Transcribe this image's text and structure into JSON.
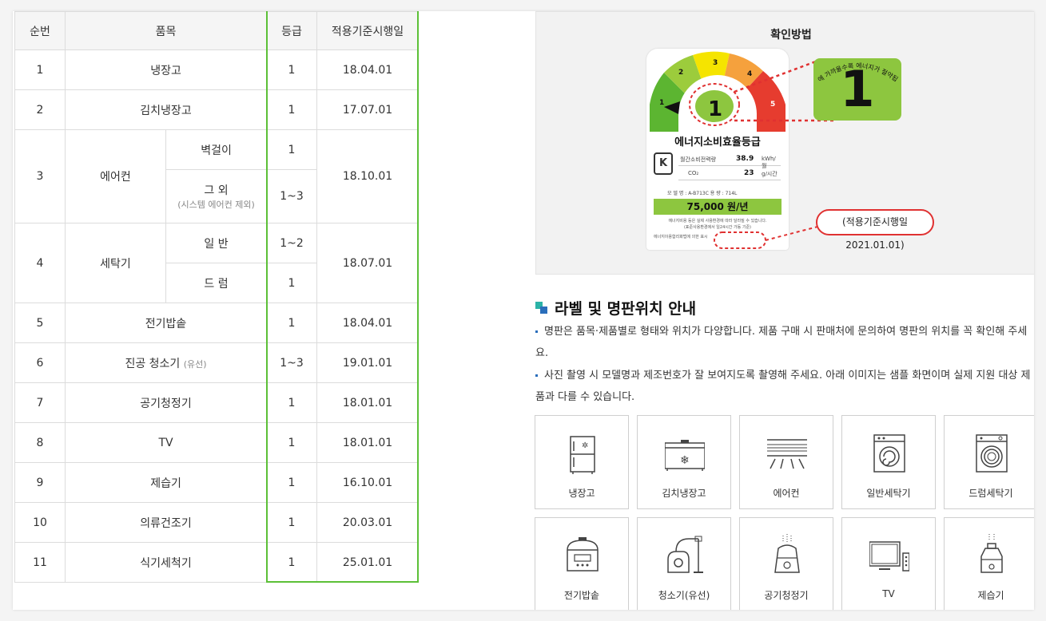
{
  "table": {
    "headers": {
      "no": "순번",
      "item": "품목",
      "grade": "등급",
      "date": "적용기준시행일"
    },
    "rows": [
      {
        "no": "1",
        "item": "냉장고",
        "grade": "1",
        "date": "18.04.01"
      },
      {
        "no": "2",
        "item": "김치냉장고",
        "grade": "1",
        "date": "17.07.01"
      },
      {
        "no": "3",
        "item": "에어컨",
        "date": "18.10.01",
        "sub": [
          {
            "name": "벽걸이",
            "grade": "1"
          },
          {
            "name": "그 외",
            "note": "(시스템 에어컨 제외)",
            "grade": "1~3"
          }
        ]
      },
      {
        "no": "4",
        "item": "세탁기",
        "date": "18.07.01",
        "sub": [
          {
            "name": "일 반",
            "grade": "1~2"
          },
          {
            "name": "드 럼",
            "grade": "1"
          }
        ]
      },
      {
        "no": "5",
        "item": "전기밥솥",
        "grade": "1",
        "date": "18.04.01"
      },
      {
        "no": "6",
        "item": "진공 청소기",
        "item_note": "(유선)",
        "grade": "1~3",
        "date": "19.01.01"
      },
      {
        "no": "7",
        "item": "공기청정기",
        "grade": "1",
        "date": "18.01.01"
      },
      {
        "no": "8",
        "item": "TV",
        "grade": "1",
        "date": "18.01.01"
      },
      {
        "no": "9",
        "item": "제습기",
        "grade": "1",
        "date": "16.10.01"
      },
      {
        "no": "10",
        "item": "의류건조기",
        "grade": "1",
        "date": "20.03.01"
      },
      {
        "no": "11",
        "item": "식기세척기",
        "grade": "1",
        "date": "25.01.01"
      }
    ]
  },
  "check": {
    "title": "확인방법",
    "label": {
      "gauge_numbers": [
        "1",
        "2",
        "3",
        "4",
        "5"
      ],
      "gauge_colors": [
        "#5cb531",
        "#9ccc3c",
        "#f5e400",
        "#f5a13d",
        "#e63c2f"
      ],
      "grade": "1",
      "title": "에너지소비효율등급",
      "kc": "K",
      "spec1_label": "월간소비전력량",
      "spec1_value": "38.9",
      "spec1_unit": "kWh/월",
      "spec2_label": "CO₂",
      "spec2_value": "23",
      "spec2_unit": "g/시간",
      "model": "모 델 명 : A-B713C        용    량 : 714L",
      "cost": "75,000 원/년",
      "fine1": "에너지비용 등은 실제 사용환경에 따라 달라질 수 있습니다.",
      "fine2": "(표준사용환경에서 일24시간 가동 기준)",
      "law": "에너지이용합리화법에 의한 표시"
    },
    "badge_arc_text": "에너지가 절약됩니다",
    "badge_arc_text_prefix": "에 가까울수록",
    "badge_grade": "1",
    "date_note": "(적용기준시행일 2021.01.01)",
    "highlight_color": "#e03131"
  },
  "guide": {
    "title": "라벨 및 명판위치 안내",
    "bullets": [
      "명판은 품목·제품별로 형태와 위치가 다양합니다. 제품 구매 시 판매처에 문의하여 명판의 위치를 꼭 확인해 주세요.",
      "사진 촬영 시 모델명과 제조번호가 잘 보여지도록 촬영해 주세요. 아래 이미지는 샘플 화면이며 실제 지원 대상 제품과 다를 수 있습니다."
    ],
    "accent_colors": [
      "#2bb3a7",
      "#2a6ebb"
    ]
  },
  "tiles": [
    {
      "icon": "refrigerator-icon",
      "label": "냉장고"
    },
    {
      "icon": "kimchi-refrigerator-icon",
      "label": "김치냉장고"
    },
    {
      "icon": "air-conditioner-icon",
      "label": "에어컨"
    },
    {
      "icon": "top-load-washer-icon",
      "label": "일반세탁기"
    },
    {
      "icon": "drum-washer-icon",
      "label": "드럼세탁기"
    },
    {
      "icon": "rice-cooker-icon",
      "label": "전기밥솥"
    },
    {
      "icon": "vacuum-cleaner-icon",
      "label": "청소기(유선)"
    },
    {
      "icon": "air-purifier-icon",
      "label": "공기청정기"
    },
    {
      "icon": "tv-icon",
      "label": "TV"
    },
    {
      "icon": "dehumidifier-icon",
      "label": "제습기"
    }
  ]
}
